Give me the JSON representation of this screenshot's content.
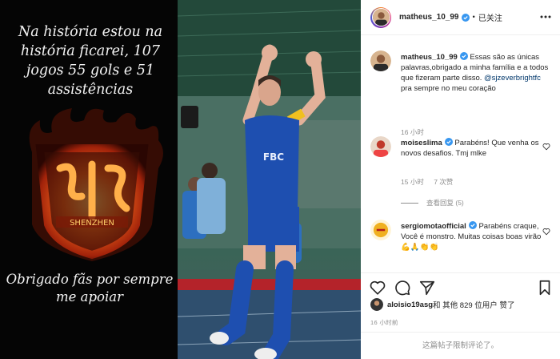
{
  "story": {
    "headline": "Na história estou na história ficarei, 107 jogos 55 gols e 51 assistências",
    "thanks": "Obrigado fãs por sempre me apoiar",
    "crest_text": "SHENZHEN"
  },
  "photo": {
    "jersey_text": "FBC"
  },
  "post": {
    "username": "matheus_10_99",
    "follow_label": "已关注",
    "caption_user": "matheus_10_99",
    "caption_text": " Essas são as únicas palavras,obrigado a minha família e a todos que fizeram parte disso. ",
    "caption_mention": "@sjzeverbrightfc",
    "caption_tail": " pra sempre no meu coração",
    "caption_time": "16 小时"
  },
  "comments": [
    {
      "user": "moiseslima",
      "text": " Parabéns! Que venha os novos desafios. Tmj mlke",
      "time": "15 小时",
      "likes": "7 次赞",
      "view_replies": "查看回复 (5)"
    },
    {
      "user": "sergiomotaofficial",
      "text": " Parabéns craque,\nVocê é monstro. Muitas coisas boas virão ",
      "emoji": "💪🙏👏👏"
    }
  ],
  "likes": {
    "user": "aloisio19asg",
    "text": " 和 其他 829 位用户 赞了"
  },
  "timestamp": "16 小时前",
  "comments_limited": "这篇帖子限制评论了。",
  "colors": {
    "verified": "#3897f0",
    "link": "#00376b",
    "meta": "#8e8e8e",
    "jersey": "#1e4fb0",
    "flame": "#f2671c"
  }
}
